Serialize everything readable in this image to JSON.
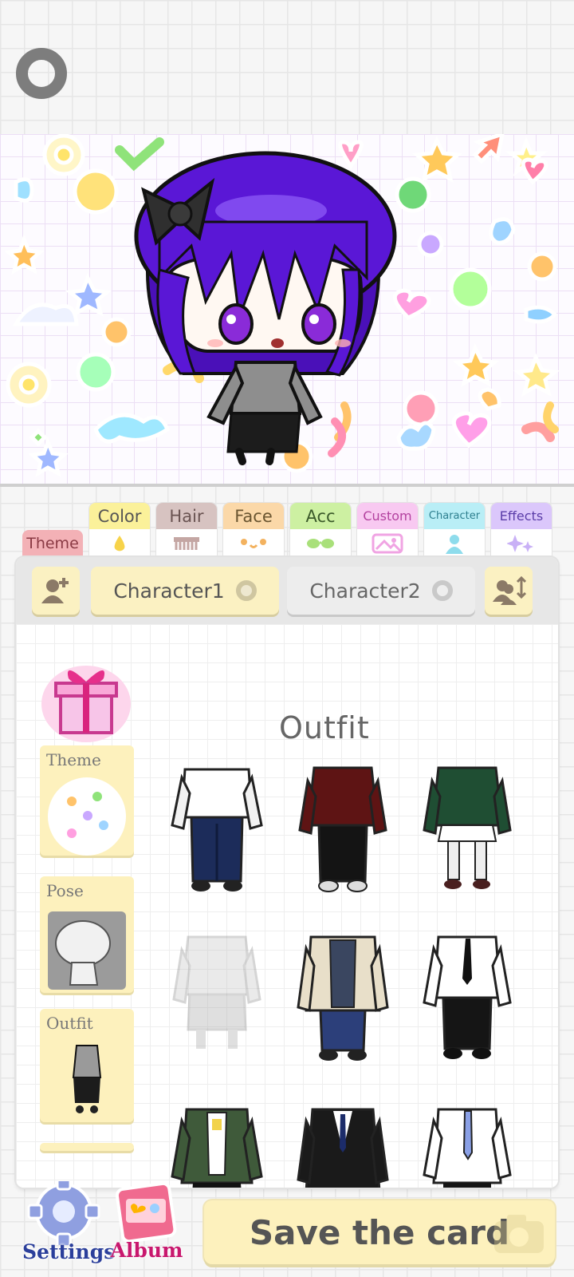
{
  "tabs": {
    "theme": "Theme",
    "color": "Color",
    "hair": "Hair",
    "face": "Face",
    "acc": "Acc",
    "custom": "Custom",
    "character": "Character",
    "effects": "Effects"
  },
  "characters": {
    "character1": "Character1",
    "character2": "Character2"
  },
  "panel": {
    "title": "Outfit"
  },
  "side_menu": {
    "theme": "Theme",
    "pose": "Pose",
    "outfit": "Outfit"
  },
  "bottom": {
    "settings": "Settings",
    "album": "Album",
    "save": "Save the card"
  },
  "colors": {
    "tab_theme": "#f3b1b6",
    "tab_color": "#fbf19a",
    "tab_hair": "#d7c3c1",
    "tab_face": "#fbd8a8",
    "tab_acc": "#cdf0a2",
    "tab_custom": "#f8c9f1",
    "tab_character": "#b9eef6",
    "tab_effects": "#dbc7fb",
    "card_yellow": "#fdf1bd",
    "hair_purple": "#5a17d6"
  }
}
